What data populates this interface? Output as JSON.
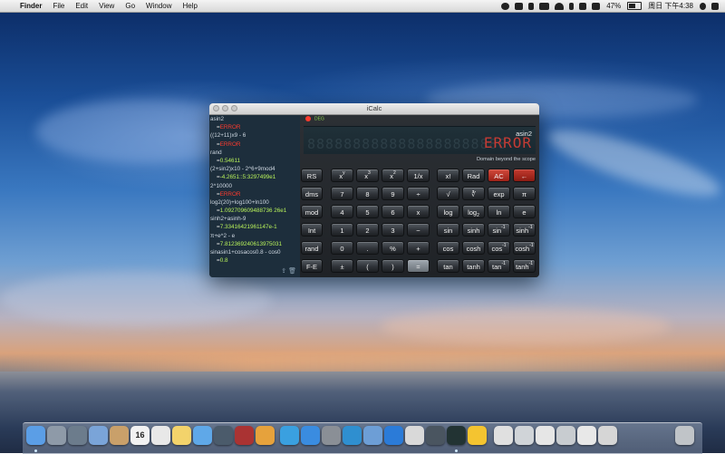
{
  "menubar": {
    "apple_symbol": "",
    "app_name": "Finder",
    "menus": [
      "File",
      "Edit",
      "View",
      "Go",
      "Window",
      "Help"
    ],
    "battery": "47%",
    "clock": "周日 下午4:38"
  },
  "icalc": {
    "title": "iCalc",
    "mode": "DEG",
    "display": {
      "expression": "asin2",
      "value": "ERROR",
      "message": "Domain beyond the scope",
      "digit_mask": "8888888888888888888888"
    },
    "history": [
      {
        "expr": "asin2",
        "result": "ERROR",
        "status": "error"
      },
      {
        "expr": "((12+11)x9 - 6",
        "result": "ERROR",
        "status": "error"
      },
      {
        "expr": "rand",
        "result": "0.54611",
        "status": "ok"
      },
      {
        "expr": "(2+sin2)x10 - 2^6+9mod4",
        "result": "-4.2651::5:3297499e1",
        "status": "ok"
      },
      {
        "expr": "2^10000",
        "result": "ERROR",
        "status": "error"
      },
      {
        "expr": "log2(20)+log100+ln100",
        "result": "1.092709609488736 26e1",
        "status": "ok"
      },
      {
        "expr": "sinh2+asinh-9",
        "result": "7.33416421961147e-1",
        "status": "ok"
      },
      {
        "expr": "π+e^2 - e",
        "result": "7.812369240613975031",
        "status": "ok"
      },
      {
        "expr": "sinasin1+cosacos0.8 - cos0",
        "result": "0.8",
        "status": "ok"
      }
    ],
    "side_keys": [
      "RS",
      "dms",
      "mod",
      "Int",
      "rand",
      "F-E"
    ],
    "keys": [
      [
        {
          "label": "x",
          "sup": "y"
        },
        {
          "label": "x",
          "sup": "3"
        },
        {
          "label": "x",
          "sup": "2"
        },
        {
          "label": "1/x"
        },
        {
          "label": "x!"
        },
        {
          "label": "Rad"
        },
        {
          "label": "AC"
        },
        {
          "label": "←"
        }
      ],
      [
        {
          "label": "7"
        },
        {
          "label": "8"
        },
        {
          "label": "9"
        },
        {
          "label": "÷"
        },
        {
          "label": "√"
        },
        {
          "label": "∛"
        },
        {
          "label": "exp"
        },
        {
          "label": "π"
        }
      ],
      [
        {
          "label": "4"
        },
        {
          "label": "5"
        },
        {
          "label": "6"
        },
        {
          "label": "x"
        },
        {
          "label": "log"
        },
        {
          "label": "log",
          "sub": "2"
        },
        {
          "label": "ln"
        },
        {
          "label": "e"
        }
      ],
      [
        {
          "label": "1"
        },
        {
          "label": "2"
        },
        {
          "label": "3"
        },
        {
          "label": "−"
        },
        {
          "label": "sin"
        },
        {
          "label": "sinh"
        },
        {
          "label": "sin",
          "sup": "-1"
        },
        {
          "label": "sinh",
          "sup": "-1"
        }
      ],
      [
        {
          "label": "0"
        },
        {
          "label": "."
        },
        {
          "label": "%"
        },
        {
          "label": "+"
        },
        {
          "label": "cos"
        },
        {
          "label": "cosh"
        },
        {
          "label": "cos",
          "sup": "-1"
        },
        {
          "label": "cosh",
          "sup": "-1"
        }
      ],
      [
        {
          "label": "±"
        },
        {
          "label": "("
        },
        {
          "label": ")"
        },
        {
          "label": "="
        },
        {
          "label": "tan"
        },
        {
          "label": "tanh"
        },
        {
          "label": "tan",
          "sup": "-1"
        },
        {
          "label": "tanh",
          "sup": "-1"
        }
      ]
    ]
  },
  "dock": {
    "icons": [
      "finder",
      "launchpad",
      "mission-control",
      "preview",
      "contacts",
      "calendar",
      "reminders",
      "notes",
      "messages",
      "facetime",
      "photo-booth",
      "iphoto",
      "itunes",
      "app-store",
      "system-preferences",
      "finder-extra",
      "mail",
      "safari",
      "text-edit",
      "activity",
      "icalc",
      "qq",
      "window-1",
      "window-2",
      "window-3",
      "window-4",
      "window-5",
      "window-6",
      "trash"
    ],
    "calendar_day": "16"
  },
  "colors": {
    "error": "#ff3b2e",
    "ok": "#b8f25a",
    "accent_ac": "#d24a3c"
  }
}
